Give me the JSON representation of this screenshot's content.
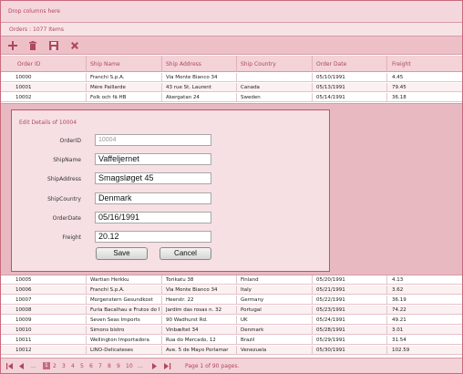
{
  "group_panel": {
    "text": "Drop columns here"
  },
  "title": "Orders : 1077 Items",
  "toolbar": [
    "add-icon",
    "delete-icon",
    "save-icon",
    "cancel-icon"
  ],
  "columns": [
    "Order ID",
    "Ship Name",
    "Ship Address",
    "Ship Country",
    "Order Date",
    "Freight"
  ],
  "rows_top": [
    [
      "10000",
      "Franchi S.p.A.",
      "Via Monte Bianco 34",
      "",
      "05/10/1991",
      "4.45"
    ],
    [
      "10001",
      "Mère Paillarde",
      "43 rue St. Laurent",
      "Canada",
      "05/13/1991",
      "79.45"
    ],
    [
      "10002",
      "Folk och fä HB",
      "Åkergatan 24",
      "Sweden",
      "05/14/1991",
      "36.18"
    ]
  ],
  "edit_form": {
    "title": "Edit Details of 10004",
    "fields": [
      {
        "label": "OrderID",
        "value": "10004"
      },
      {
        "label": "ShipName",
        "value": "Vaffeljernet"
      },
      {
        "label": "ShipAddress",
        "value": "Smagsløget 45"
      },
      {
        "label": "ShipCountry",
        "value": "Denmark"
      },
      {
        "label": "OrderDate",
        "value": "05/16/1991"
      },
      {
        "label": "Freight",
        "value": "20.12"
      }
    ],
    "save_label": "Save",
    "cancel_label": "Cancel"
  },
  "rows_bottom": [
    [
      "10005",
      "Wartian Herkku",
      "Torikatu 38",
      "Finland",
      "05/20/1991",
      "4.13"
    ],
    [
      "10006",
      "Franchi S.p.A.",
      "Via Monte Bianco 34",
      "Italy",
      "05/21/1991",
      "3.62"
    ],
    [
      "10007",
      "Morgenstern Gesundkost",
      "Heerstr. 22",
      "Germany",
      "05/22/1991",
      "36.19"
    ],
    [
      "10008",
      "Furia Bacalhau e Frutos do Ma",
      "Jardim das rosas n. 32",
      "Portugal",
      "05/23/1991",
      "74.22"
    ],
    [
      "10009",
      "Seven Seas Imports",
      "90 Wadhurst Rd.",
      "UK",
      "05/24/1991",
      "49.21"
    ],
    [
      "10010",
      "Simons bistro",
      "Vinbæltet 34",
      "Denmark",
      "05/28/1991",
      "3.01"
    ],
    [
      "10011",
      "Wellington Importadora",
      "Rua do Mercado, 12",
      "Brazil",
      "05/29/1991",
      "31.54"
    ],
    [
      "10012",
      "LINO-Delicateses",
      "Ave. 5 de Mayo Porlamar",
      "Venezuela",
      "05/30/1991",
      "102.59"
    ]
  ],
  "pager": {
    "pages": [
      "1",
      "2",
      "3",
      "4",
      "5",
      "6",
      "7",
      "8",
      "9",
      "10"
    ],
    "ellipsis_left": "...",
    "ellipsis_right": "...",
    "info": "Page 1 of 90 pages."
  },
  "colors": {
    "accent": "#b0475c",
    "border": "#c96a7d",
    "header_bg": "#f3d2d8",
    "edit_bg": "#e8b9c1"
  }
}
